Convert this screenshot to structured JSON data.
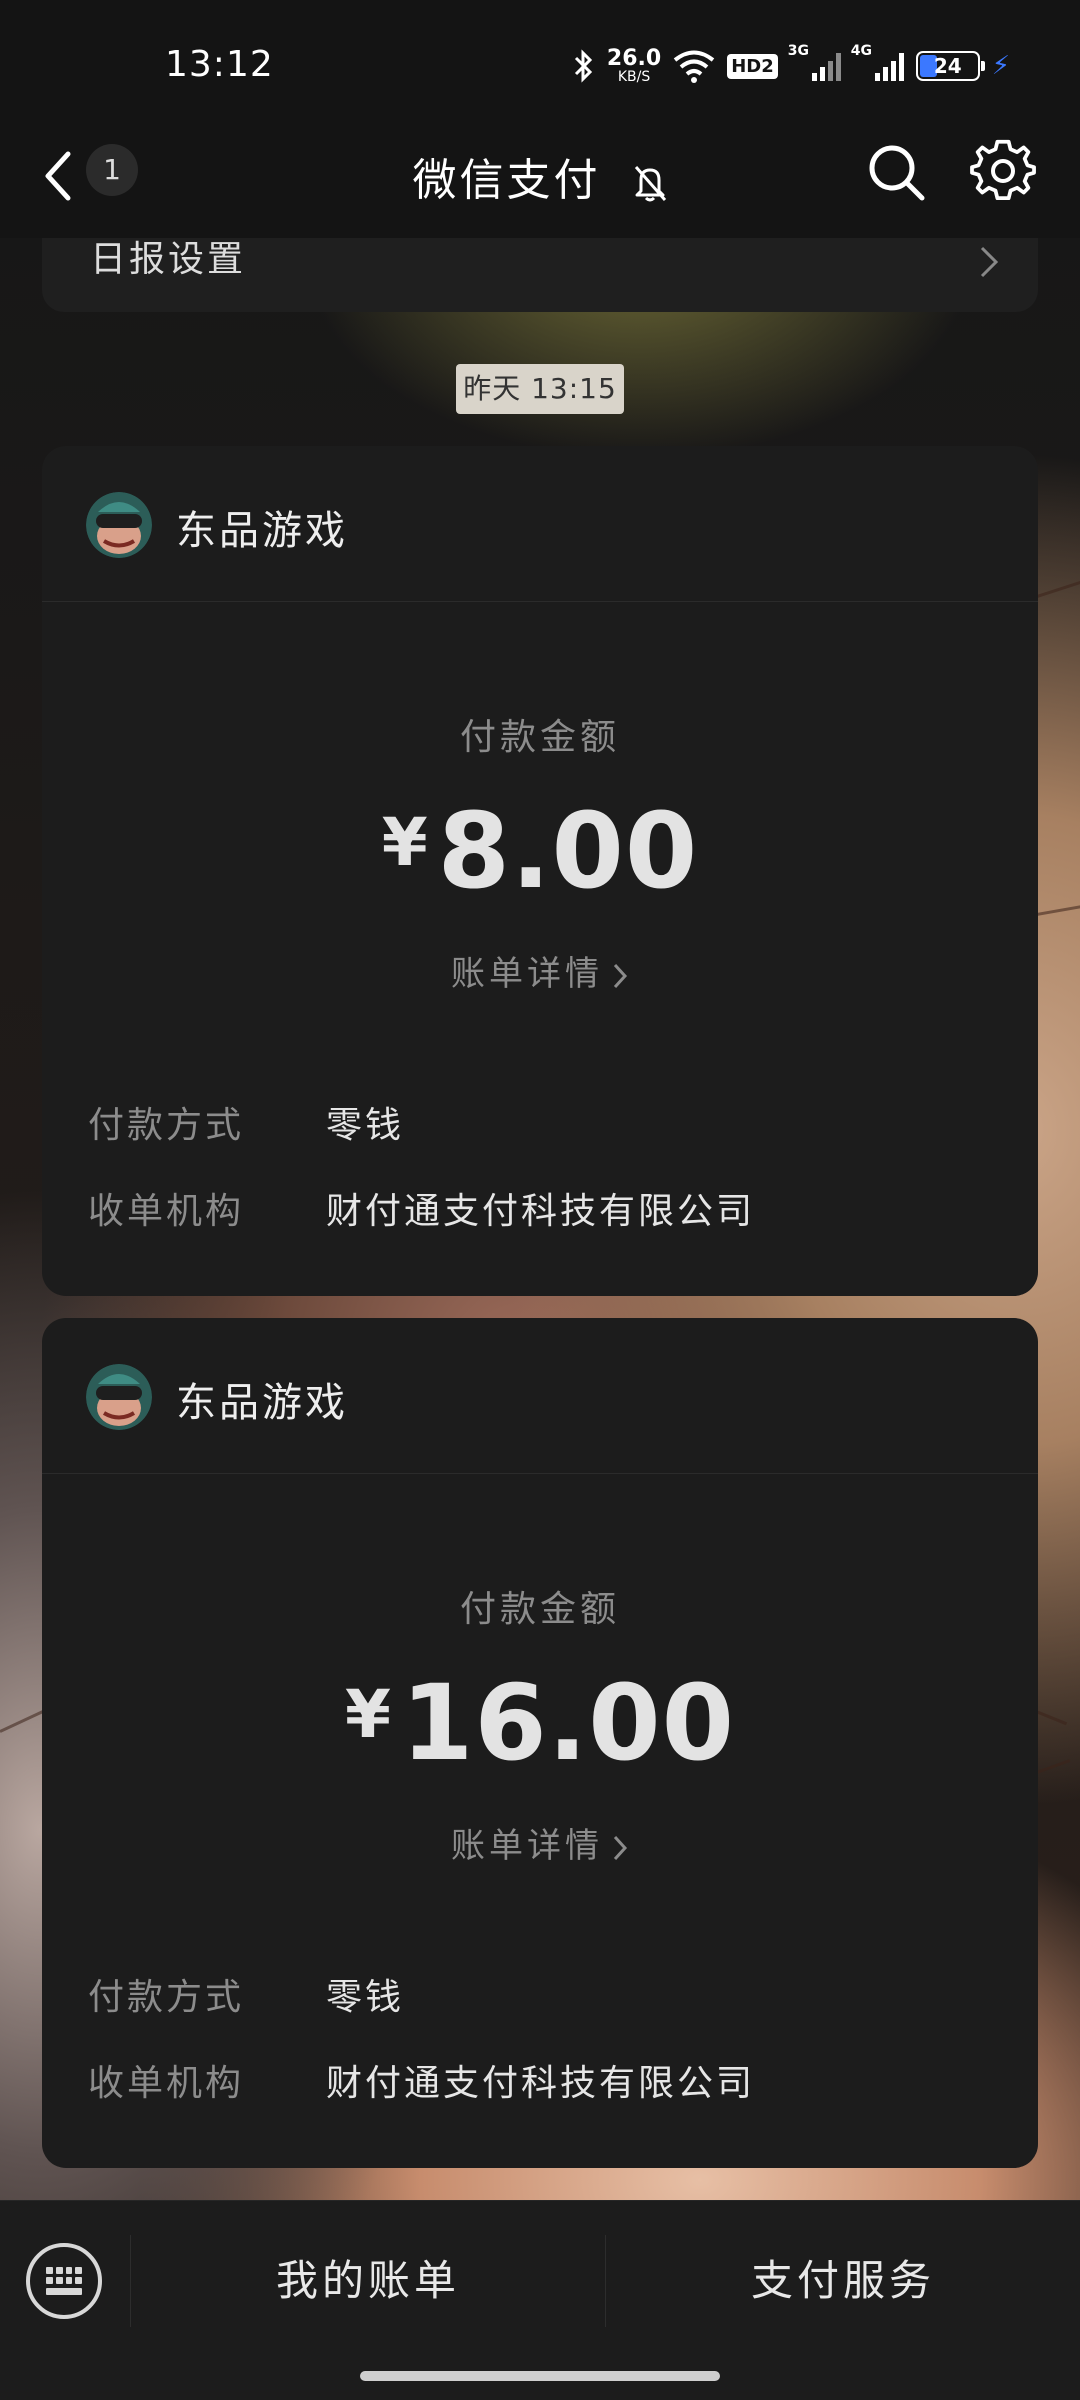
{
  "status_bar": {
    "time": "13:12",
    "net_speed_value": "26.0",
    "net_speed_unit": "KB/S",
    "hd_label": "HD2",
    "signal_1_label": "3G",
    "signal_2_label": "4G",
    "battery_level": "24"
  },
  "nav": {
    "unread_count": "1",
    "title": "微信支付"
  },
  "daily_report": {
    "label": "日报设置"
  },
  "timestamp": "昨天 13:15",
  "cards": [
    {
      "merchant": "东品游戏",
      "amount_label": "付款金额",
      "currency": "¥",
      "amount": "8.00",
      "detail_label": "账单详情",
      "payment_method_label": "付款方式",
      "payment_method": "零钱",
      "acquirer_label": "收单机构",
      "acquirer": "财付通支付科技有限公司"
    },
    {
      "merchant": "东品游戏",
      "amount_label": "付款金额",
      "currency": "¥",
      "amount": "16.00",
      "detail_label": "账单详情",
      "payment_method_label": "付款方式",
      "payment_method": "零钱",
      "acquirer_label": "收单机构",
      "acquirer": "财付通支付科技有限公司"
    }
  ],
  "bottom_menu": {
    "item_1": "我的账单",
    "item_2": "支付服务"
  }
}
